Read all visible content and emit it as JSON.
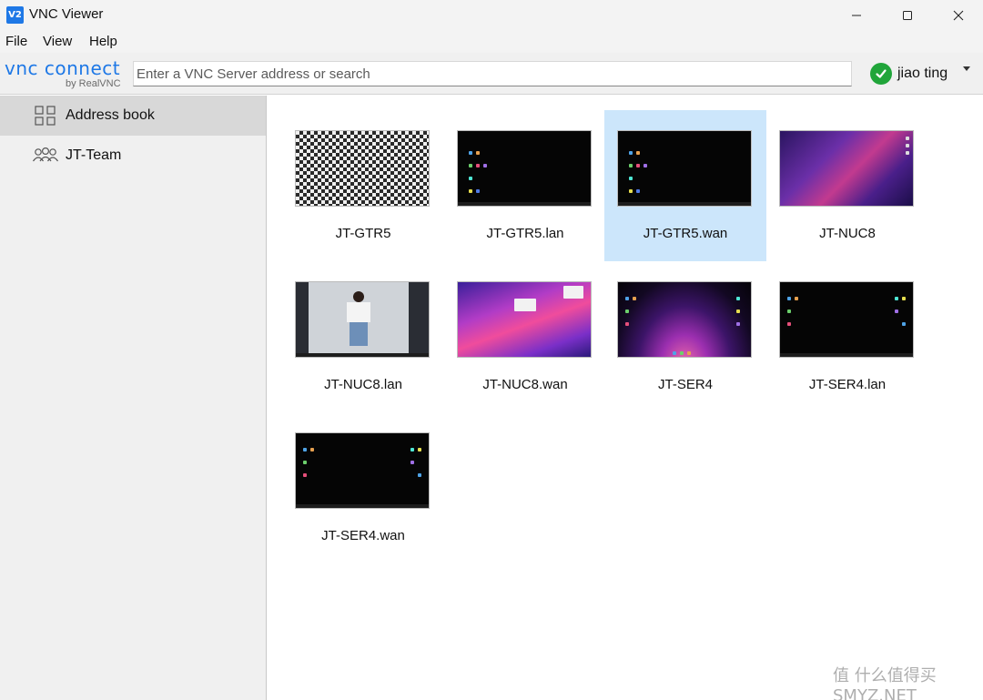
{
  "window": {
    "icon_text": "V2",
    "title": "VNC Viewer"
  },
  "menu": {
    "items": [
      "File",
      "View",
      "Help"
    ]
  },
  "toolbar": {
    "logo_main": "vnc connect",
    "logo_sub": "by RealVNC",
    "search_placeholder": "Enter a VNC Server address or search",
    "user_name": "jiao ting",
    "status_color": "#20a53a",
    "accent_color": "#1e78e6"
  },
  "sidebar": {
    "items": [
      {
        "label": "Address book",
        "icon": "grid-icon",
        "active": true
      },
      {
        "label": "JT-Team",
        "icon": "team-icon",
        "active": false
      }
    ]
  },
  "connections": [
    {
      "label": "JT-GTR5",
      "thumbnail": "checker"
    },
    {
      "label": "JT-GTR5.lan",
      "thumbnail": "black-desktop"
    },
    {
      "label": "JT-GTR5.wan",
      "thumbnail": "black-desktop",
      "selected": true
    },
    {
      "label": "JT-NUC8",
      "thumbnail": "purple-wave"
    },
    {
      "label": "JT-NUC8.lan",
      "thumbnail": "photo"
    },
    {
      "label": "JT-NUC8.wan",
      "thumbnail": "monterey"
    },
    {
      "label": "JT-SER4",
      "thumbnail": "ser4-glow"
    },
    {
      "label": "JT-SER4.lan",
      "thumbnail": "black-desktop"
    },
    {
      "label": "JT-SER4.wan",
      "thumbnail": "black-desktop"
    }
  ],
  "watermark": "值 什么值得买 SMYZ.NET"
}
